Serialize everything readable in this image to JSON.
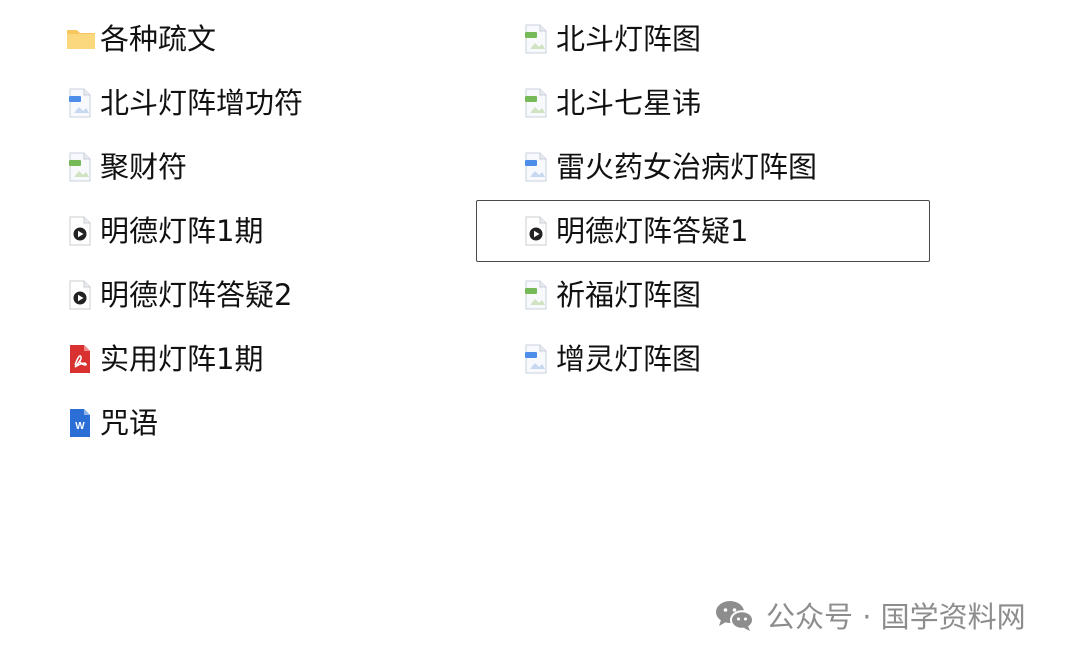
{
  "files": {
    "left": [
      {
        "name": "各种疏文",
        "type": "folder",
        "icon": "folder-icon",
        "selected": false
      },
      {
        "name": "北斗灯阵增功符",
        "type": "jpg",
        "icon": "jpg-image-icon",
        "selected": false
      },
      {
        "name": "聚财符",
        "type": "png",
        "icon": "png-image-icon",
        "selected": false
      },
      {
        "name": "明德灯阵1期",
        "type": "video",
        "icon": "video-file-icon",
        "selected": false
      },
      {
        "name": "明德灯阵答疑2",
        "type": "video",
        "icon": "video-file-icon",
        "selected": false
      },
      {
        "name": "实用灯阵1期",
        "type": "pdf",
        "icon": "pdf-file-icon",
        "selected": false
      },
      {
        "name": "咒语",
        "type": "word",
        "icon": "word-document-icon",
        "selected": false
      }
    ],
    "right": [
      {
        "name": "北斗灯阵图",
        "type": "png",
        "icon": "png-image-icon",
        "selected": false
      },
      {
        "name": "北斗七星讳",
        "type": "png",
        "icon": "png-image-icon",
        "selected": false
      },
      {
        "name": "雷火药女治病灯阵图",
        "type": "jpg",
        "icon": "jpg-image-icon",
        "selected": false
      },
      {
        "name": "明德灯阵答疑1",
        "type": "video",
        "icon": "video-file-icon",
        "selected": true
      },
      {
        "name": "祈福灯阵图",
        "type": "png",
        "icon": "png-image-icon",
        "selected": false
      },
      {
        "name": "增灵灯阵图",
        "type": "jpg",
        "icon": "jpg-image-icon",
        "selected": false
      }
    ]
  },
  "watermark": {
    "text": "公众号 · 国学资料网",
    "icon": "wechat-icon"
  },
  "colors": {
    "folder": "#f7c65f",
    "jpg_badge": "#4f8ee8",
    "png_badge": "#76b957",
    "video_dot": "#222222",
    "pdf": "#d93030",
    "word": "#2b6fd6",
    "selection_border": "#4a4a4a",
    "watermark": "#8d8d8d"
  }
}
